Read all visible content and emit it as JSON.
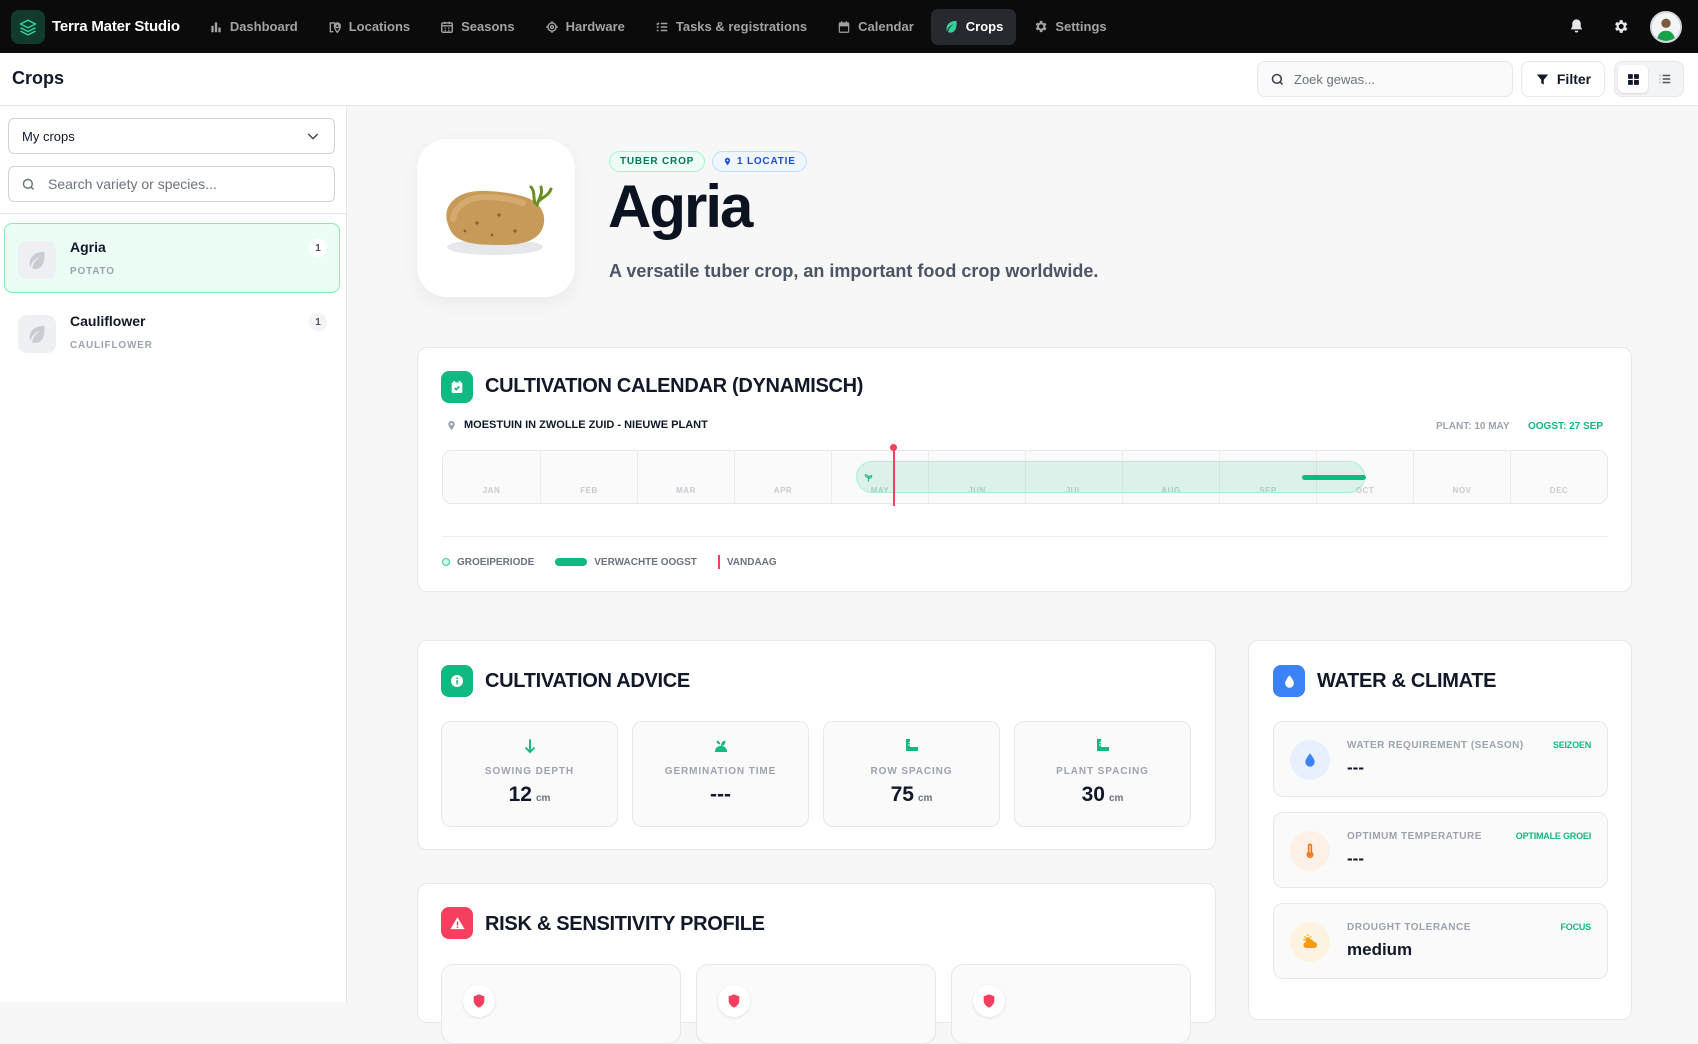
{
  "app": {
    "name": "Terra Mater Studio"
  },
  "nav": {
    "items": [
      {
        "label": "Dashboard",
        "icon": "bar-chart-icon"
      },
      {
        "label": "Locations",
        "icon": "map-pin-icon"
      },
      {
        "label": "Seasons",
        "icon": "calendar-grid-icon"
      },
      {
        "label": "Hardware",
        "icon": "cpu-icon"
      },
      {
        "label": "Tasks & registrations",
        "icon": "list-check-icon"
      },
      {
        "label": "Calendar",
        "icon": "calendar-icon"
      },
      {
        "label": "Crops",
        "icon": "leaf-icon",
        "active": true
      },
      {
        "label": "Settings",
        "icon": "gear-icon"
      }
    ]
  },
  "header": {
    "title": "Crops",
    "search_placeholder": "Zoek gewas...",
    "filter_label": "Filter",
    "view_mode": "grid"
  },
  "sidebar": {
    "select_value": "My crops",
    "search_placeholder": "Search variety or species...",
    "items": [
      {
        "name": "Agria",
        "species": "POTATO",
        "count": "1",
        "active": true
      },
      {
        "name": "Cauliflower",
        "species": "CAULIFLOWER",
        "count": "1",
        "active": false
      }
    ]
  },
  "crop": {
    "category_tag": "TUBER CROP",
    "location_tag": "1 LOCATIE",
    "name": "Agria",
    "description": "A versatile tuber crop, an important food crop worldwide."
  },
  "calendar": {
    "title": "CULTIVATION CALENDAR (DYNAMISCH)",
    "location": "MOESTUIN IN ZWOLLE ZUID - NIEUWE PLANT",
    "plant_label": "PLANT: 10 MAY",
    "harvest_label": "OOGST: 27 SEP",
    "months": [
      "JAN",
      "FEB",
      "MAR",
      "APR",
      "MAY",
      "JUN",
      "JUL",
      "AUG",
      "SEP",
      "OCT",
      "NOV",
      "DEC"
    ],
    "legend": {
      "growth": "GROEIPERIODE",
      "harvest": "VERWACHTE OOGST",
      "today": "VANDAAG"
    },
    "colors": {
      "growth": "#a7f3d0",
      "harvest": "#10b981",
      "today": "#f43f5e"
    }
  },
  "advice": {
    "title": "CULTIVATION ADVICE",
    "stats": [
      {
        "label": "SOWING DEPTH",
        "value": "12",
        "unit": "cm",
        "icon": "arrow-down-icon"
      },
      {
        "label": "GERMINATION TIME",
        "value": "---",
        "unit": "",
        "icon": "sprout-sun-icon"
      },
      {
        "label": "ROW SPACING",
        "value": "75",
        "unit": "cm",
        "icon": "ruler-icon"
      },
      {
        "label": "PLANT SPACING",
        "value": "30",
        "unit": "cm",
        "icon": "ruler-icon"
      }
    ]
  },
  "water": {
    "title": "WATER & CLIMATE",
    "items": [
      {
        "label": "WATER REQUIREMENT (SEASON)",
        "tag": "SEIZOEN",
        "value": "---",
        "icon": "droplet-icon"
      },
      {
        "label": "OPTIMUM TEMPERATURE",
        "tag": "OPTIMALE GROEI",
        "value": "---",
        "icon": "thermometer-icon"
      },
      {
        "label": "DROUGHT TOLERANCE",
        "tag": "FOCUS",
        "value": "medium",
        "icon": "sun-cloud-icon"
      }
    ]
  },
  "risk": {
    "title": "RISK & SENSITIVITY PROFILE"
  }
}
